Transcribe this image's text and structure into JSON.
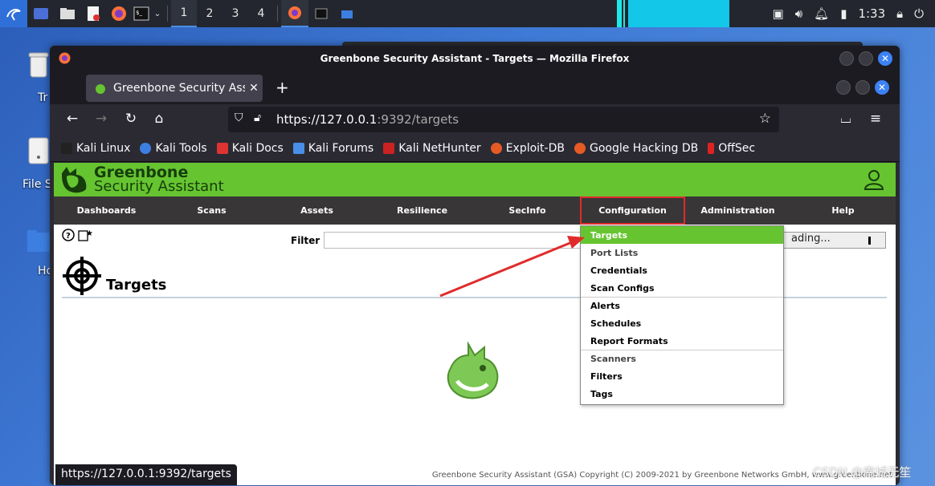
{
  "desktop": {
    "icons": [
      {
        "label": "Tr",
        "name": "trash"
      },
      {
        "label": "File S",
        "name": "file-system"
      },
      {
        "label": "Ho",
        "name": "home"
      }
    ]
  },
  "taskbar": {
    "workspaces": [
      "1",
      "2",
      "3",
      "4"
    ],
    "active_workspace": "1",
    "clock": "1:33"
  },
  "window": {
    "title": "Greenbone Security Assistant - Targets — Mozilla Firefox"
  },
  "browser": {
    "tab_title": "Greenbone Security Assist",
    "url_host": "https://127.0.0.1",
    "url_rest": ":9392/targets",
    "bookmarks": [
      "Kali Linux",
      "Kali Tools",
      "Kali Docs",
      "Kali Forums",
      "Kali NetHunter",
      "Exploit-DB",
      "Google Hacking DB",
      "OffSec"
    ],
    "status_url": "https://127.0.0.1:9392/targets"
  },
  "gsa": {
    "brand_line1": "Greenbone",
    "brand_line2": "Security Assistant",
    "menu": [
      "Dashboards",
      "Scans",
      "Assets",
      "Resilience",
      "SecInfo",
      "Configuration",
      "Administration",
      "Help"
    ],
    "highlighted_menu": "Configuration",
    "filter_label": "Filter",
    "loading_text": "ading...",
    "page_title": "Targets",
    "dropdown": [
      {
        "label": "Targets",
        "active": true
      },
      {
        "label": "Port Lists"
      },
      {
        "label": "Credentials"
      },
      {
        "label": "Scan Configs"
      },
      {
        "label": "Alerts",
        "sep": true
      },
      {
        "label": "Schedules"
      },
      {
        "label": "Report Formats"
      },
      {
        "label": "Scanners",
        "sep": true,
        "muted": true
      },
      {
        "label": "Filters"
      },
      {
        "label": "Tags"
      }
    ],
    "footer": "Greenbone Security Assistant (GSA) Copyright (C) 2009-2021 by Greenbone Networks GmbH, www.greenbone.net"
  },
  "watermark": "CSDN @南城无笙",
  "colors": {
    "gsa_green": "#66c430",
    "menu_bg": "#393637",
    "highlight_red": "#e12b2b"
  }
}
